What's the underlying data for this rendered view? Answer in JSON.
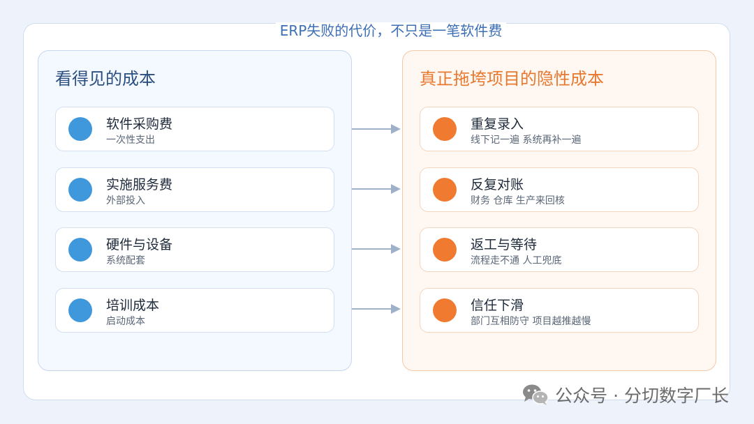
{
  "title": "ERP失败的代价，不只是一笔软件费",
  "left_panel": {
    "title": "看得见的成本",
    "items": [
      {
        "title": "软件采购费",
        "subtitle": "一次性支出"
      },
      {
        "title": "实施服务费",
        "subtitle": "外部投入"
      },
      {
        "title": "硬件与设备",
        "subtitle": "系统配套"
      },
      {
        "title": "培训成本",
        "subtitle": "启动成本"
      }
    ]
  },
  "right_panel": {
    "title": "真正拖垮项目的隐性成本",
    "items": [
      {
        "title": "重复录入",
        "subtitle": "线下记一遍  系统再补一遍"
      },
      {
        "title": "反复对账",
        "subtitle": "财务 仓库 生产来回核"
      },
      {
        "title": "返工与等待",
        "subtitle": "流程走不通  人工兜底"
      },
      {
        "title": "信任下滑",
        "subtitle": "部门互相防守  项目越推越慢"
      }
    ]
  },
  "watermark": {
    "icon": "wechat-icon",
    "text": "公众号 · 分切数字厂长"
  },
  "colors": {
    "left_accent": "#3f98dc",
    "right_accent": "#ef7a30",
    "title_blue": "#3d6fb5",
    "arrow": "#9fb1c8"
  }
}
